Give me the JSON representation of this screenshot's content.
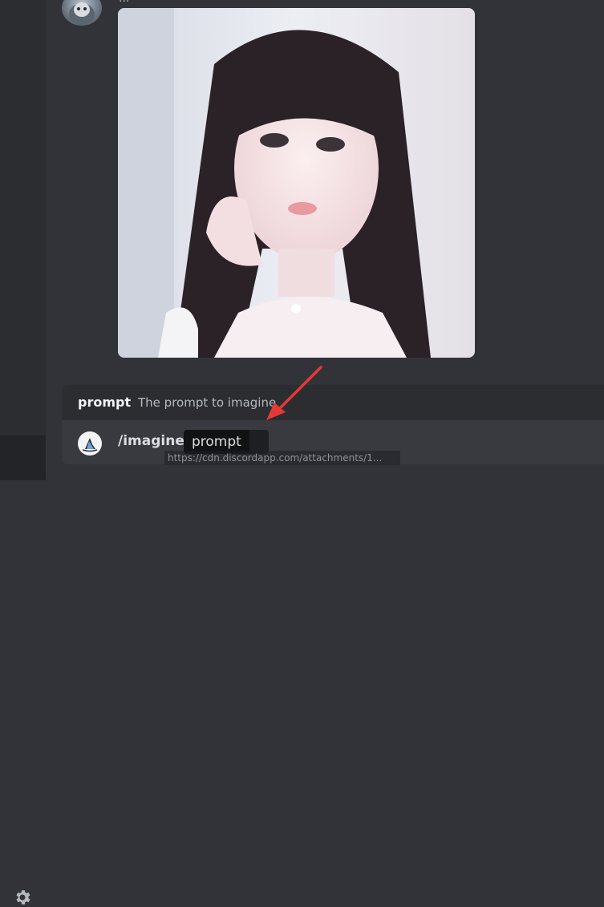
{
  "message": {
    "author": "...",
    "attachment_alt": "Portrait of a young woman with long dark hair and bangs"
  },
  "option_popup": {
    "name": "prompt",
    "description": "The prompt to imagine"
  },
  "chat_input": {
    "command": "/imagine",
    "param_label": "prompt",
    "param_value": ""
  },
  "tooltip": {
    "url": "https://cdn.discordapp.com/attachments/1..."
  },
  "icons": {
    "settings": "gear-icon",
    "bot": "midjourney-bot-icon",
    "annotation": "red-arrow-icon"
  },
  "colors": {
    "background": "#313338",
    "sidebar": "#2b2d31",
    "input": "#383a40",
    "popup": "#2b2d31",
    "annotation_arrow": "#e53935"
  }
}
